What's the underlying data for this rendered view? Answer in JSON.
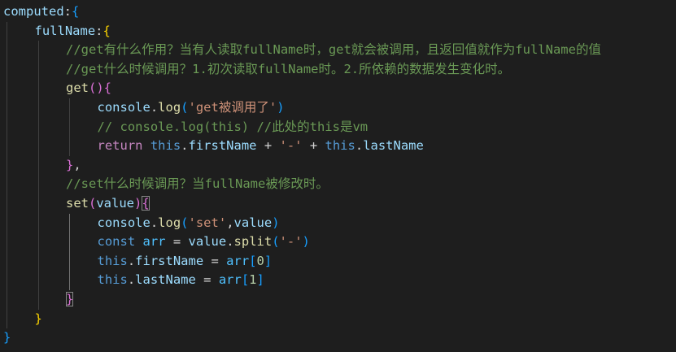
{
  "colors": {
    "background": "#1e1e1e",
    "indent_guide": "#404040",
    "indent_guide_active": "#707070",
    "bracket_match_outline": "#888888"
  },
  "lines": [
    {
      "indent": 0,
      "tokens": [
        {
          "t": "computed",
          "c": "#9cdcfe"
        },
        {
          "t": ":",
          "c": "#d4d4d4"
        },
        {
          "t": "{",
          "c": "#179fff"
        }
      ]
    },
    {
      "indent": 1,
      "tokens": [
        {
          "t": "fullName",
          "c": "#9cdcfe"
        },
        {
          "t": ":",
          "c": "#d4d4d4"
        },
        {
          "t": "{",
          "c": "#ffd700"
        }
      ]
    },
    {
      "indent": 2,
      "tokens": [
        {
          "t": "//get有什么作用？当有人读取fullName时，get就会被调用，且返回值就作为fullName的值",
          "c": "#6a9955"
        }
      ]
    },
    {
      "indent": 2,
      "tokens": [
        {
          "t": "//get什么时候调用？1.初次读取fullName时。2.所依赖的数据发生变化时。",
          "c": "#6a9955"
        }
      ]
    },
    {
      "indent": 2,
      "tokens": [
        {
          "t": "get",
          "c": "#dcdcaa"
        },
        {
          "t": "()",
          "c": "#da70d6"
        },
        {
          "t": "{",
          "c": "#da70d6"
        }
      ]
    },
    {
      "indent": 3,
      "tokens": [
        {
          "t": "console",
          "c": "#9cdcfe"
        },
        {
          "t": ".",
          "c": "#d4d4d4"
        },
        {
          "t": "log",
          "c": "#dcdcaa"
        },
        {
          "t": "(",
          "c": "#179fff"
        },
        {
          "t": "'get被调用了'",
          "c": "#ce9178"
        },
        {
          "t": ")",
          "c": "#179fff"
        }
      ]
    },
    {
      "indent": 3,
      "tokens": [
        {
          "t": "// console.log(this) //此处的this是vm",
          "c": "#6a9955"
        }
      ]
    },
    {
      "indent": 3,
      "tokens": [
        {
          "t": "return",
          "c": "#c586c0"
        },
        {
          "t": " ",
          "c": "#d4d4d4"
        },
        {
          "t": "this",
          "c": "#569cd6"
        },
        {
          "t": ".",
          "c": "#d4d4d4"
        },
        {
          "t": "firstName",
          "c": "#9cdcfe"
        },
        {
          "t": " + ",
          "c": "#d4d4d4"
        },
        {
          "t": "'-'",
          "c": "#ce9178"
        },
        {
          "t": " + ",
          "c": "#d4d4d4"
        },
        {
          "t": "this",
          "c": "#569cd6"
        },
        {
          "t": ".",
          "c": "#d4d4d4"
        },
        {
          "t": "lastName",
          "c": "#9cdcfe"
        }
      ]
    },
    {
      "indent": 2,
      "tokens": [
        {
          "t": "}",
          "c": "#da70d6"
        },
        {
          "t": ",",
          "c": "#d4d4d4"
        }
      ]
    },
    {
      "indent": 2,
      "tokens": [
        {
          "t": "//set什么时候调用？当fullName被修改时。",
          "c": "#6a9955"
        }
      ]
    },
    {
      "indent": 2,
      "tokens": [
        {
          "t": "set",
          "c": "#dcdcaa"
        },
        {
          "t": "(",
          "c": "#da70d6"
        },
        {
          "t": "value",
          "c": "#9cdcfe"
        },
        {
          "t": ")",
          "c": "#da70d6"
        },
        {
          "t": "{",
          "c": "#da70d6",
          "box": true
        }
      ]
    },
    {
      "indent": 3,
      "tokens": [
        {
          "t": "console",
          "c": "#9cdcfe"
        },
        {
          "t": ".",
          "c": "#d4d4d4"
        },
        {
          "t": "log",
          "c": "#dcdcaa"
        },
        {
          "t": "(",
          "c": "#179fff"
        },
        {
          "t": "'set'",
          "c": "#ce9178"
        },
        {
          "t": ",",
          "c": "#d4d4d4"
        },
        {
          "t": "value",
          "c": "#9cdcfe"
        },
        {
          "t": ")",
          "c": "#179fff"
        }
      ]
    },
    {
      "indent": 3,
      "tokens": [
        {
          "t": "const",
          "c": "#569cd6"
        },
        {
          "t": " ",
          "c": "#d4d4d4"
        },
        {
          "t": "arr",
          "c": "#4fc1ff"
        },
        {
          "t": " = ",
          "c": "#d4d4d4"
        },
        {
          "t": "value",
          "c": "#9cdcfe"
        },
        {
          "t": ".",
          "c": "#d4d4d4"
        },
        {
          "t": "split",
          "c": "#dcdcaa"
        },
        {
          "t": "(",
          "c": "#179fff"
        },
        {
          "t": "'-'",
          "c": "#ce9178"
        },
        {
          "t": ")",
          "c": "#179fff"
        }
      ]
    },
    {
      "indent": 3,
      "tokens": [
        {
          "t": "this",
          "c": "#569cd6"
        },
        {
          "t": ".",
          "c": "#d4d4d4"
        },
        {
          "t": "firstName",
          "c": "#9cdcfe"
        },
        {
          "t": " = ",
          "c": "#d4d4d4"
        },
        {
          "t": "arr",
          "c": "#4fc1ff"
        },
        {
          "t": "[",
          "c": "#179fff"
        },
        {
          "t": "0",
          "c": "#b5cea8"
        },
        {
          "t": "]",
          "c": "#179fff"
        }
      ]
    },
    {
      "indent": 3,
      "tokens": [
        {
          "t": "this",
          "c": "#569cd6"
        },
        {
          "t": ".",
          "c": "#d4d4d4"
        },
        {
          "t": "lastName",
          "c": "#9cdcfe"
        },
        {
          "t": " = ",
          "c": "#d4d4d4"
        },
        {
          "t": "arr",
          "c": "#4fc1ff"
        },
        {
          "t": "[",
          "c": "#179fff"
        },
        {
          "t": "1",
          "c": "#b5cea8"
        },
        {
          "t": "]",
          "c": "#179fff"
        }
      ]
    },
    {
      "indent": 2,
      "tokens": [
        {
          "t": "}",
          "c": "#da70d6",
          "box": true
        }
      ]
    },
    {
      "indent": 1,
      "tokens": [
        {
          "t": "}",
          "c": "#ffd700"
        }
      ]
    },
    {
      "indent": 0,
      "tokens": [
        {
          "t": "}",
          "c": "#179fff"
        }
      ]
    }
  ]
}
